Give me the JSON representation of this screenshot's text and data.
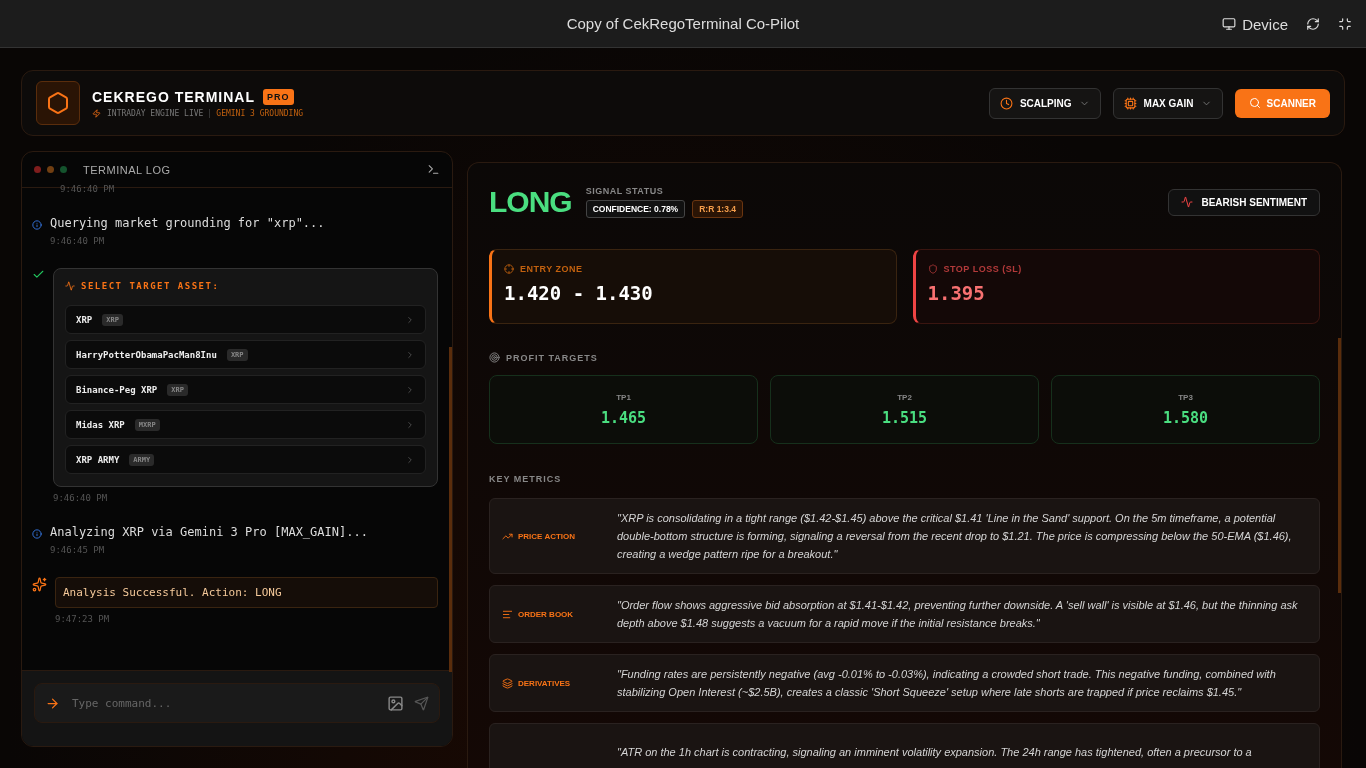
{
  "app_bar": {
    "title": "Copy of CekRegoTerminal Co-Pilot",
    "device_label": "Device"
  },
  "header": {
    "brand": "CEKREGO TERMINAL",
    "badge": "PRO",
    "status_live": "INTRADAY ENGINE LIVE",
    "status_grounding": "GEMINI 3 GROUNDING",
    "controls": [
      {
        "kind": "clock",
        "label": "SCALPING"
      },
      {
        "kind": "chip",
        "label": "MAX GAIN"
      }
    ],
    "scanner_label": "SCANNER"
  },
  "terminal": {
    "title": "TERMINAL LOG",
    "entries": [
      {
        "kind": "time",
        "time": "9:46:40 PM"
      },
      {
        "kind": "info",
        "text": "Querying market grounding for \"xrp\"...",
        "time": "9:46:40 PM"
      },
      {
        "kind": "picker",
        "title": "SELECT TARGET ASSET:",
        "time": "9:46:40 PM",
        "options": [
          {
            "name": "XRP",
            "symbol": "XRP"
          },
          {
            "name": "HarryPotterObamaPacMan8Inu",
            "symbol": "XRP"
          },
          {
            "name": "Binance-Peg XRP",
            "symbol": "XRP"
          },
          {
            "name": "Midas XRP",
            "symbol": "MXRP"
          },
          {
            "name": "XRP ARMY",
            "symbol": "ARMY"
          }
        ]
      },
      {
        "kind": "info",
        "text": "Analyzing XRP via Gemini 3 Pro [MAX_GAIN]...",
        "time": "9:46:45 PM"
      },
      {
        "kind": "success",
        "text": "Analysis Successful. Action: LONG",
        "time": "9:47:23 PM"
      }
    ],
    "placeholder": "Type command..."
  },
  "signal": {
    "action": "LONG",
    "status_label": "SIGNAL STATUS",
    "confidence": "CONFIDENCE: 0.78%",
    "rr": "R:R 1:3.4",
    "sentiment": "BEARISH SENTIMENT"
  },
  "entry": {
    "label": "ENTRY ZONE",
    "value": "1.420 - 1.430"
  },
  "stop": {
    "label": "STOP LOSS (SL)",
    "value": "1.395"
  },
  "targets": {
    "title": "PROFIT TARGETS",
    "items": [
      {
        "label": "TP1",
        "value": "1.465"
      },
      {
        "label": "TP2",
        "value": "1.515"
      },
      {
        "label": "TP3",
        "value": "1.580"
      }
    ]
  },
  "metrics": {
    "title": "KEY METRICS",
    "items": [
      {
        "kind": "trend",
        "label": "PRICE ACTION",
        "text": "\"XRP is consolidating in a tight range ($1.42-$1.45) above the critical $1.41 'Line in the Sand' support. On the 5m timeframe, a potential double-bottom structure is forming, signaling a reversal from the recent drop to $1.21. The price is compressing below the 50-EMA ($1.46), creating a wedge pattern ripe for a breakout.\""
      },
      {
        "kind": "list",
        "label": "ORDER BOOK",
        "text": "\"Order flow shows aggressive bid absorption at $1.41-$1.42, preventing further downside. A 'sell wall' is visible at $1.46, but the thinning ask depth above $1.48 suggests a vacuum for a rapid move if the initial resistance breaks.\""
      },
      {
        "kind": "layers",
        "label": "DERIVATIVES",
        "text": "\"Funding rates are persistently negative (avg -0.01% to -0.03%), indicating a crowded short trade. This negative funding, combined with stabilizing Open Interest (~$2.5B), creates a classic 'Short Squeeze' setup where late shorts are trapped if price reclaims $1.45.\""
      },
      {
        "kind": "cut",
        "text": "\"ATR on the 1h chart is contracting, signaling an imminent volatility expansion. The 24h range has tightened, often a precursor to a"
      }
    ]
  }
}
